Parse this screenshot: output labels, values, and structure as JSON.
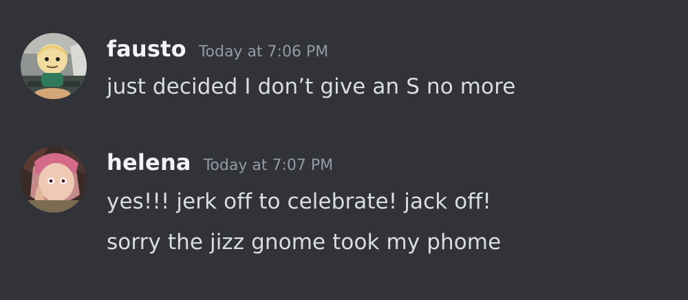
{
  "colors": {
    "background": "#313338",
    "username": "#f2f3f5",
    "timestamp": "#949ba4",
    "message_text": "#dbdee1"
  },
  "messages": [
    {
      "avatar_icon": "user-avatar-icon",
      "username": "fausto",
      "timestamp": "Today at 7:06 PM",
      "lines": [
        "just decided I don’t give an S no more"
      ]
    },
    {
      "avatar_icon": "user-avatar-icon",
      "username": "helena",
      "timestamp": "Today at 7:07 PM",
      "lines": [
        "yes!!! jerk off to celebrate! jack off!",
        "sorry the jizz gnome took my phome"
      ]
    }
  ]
}
